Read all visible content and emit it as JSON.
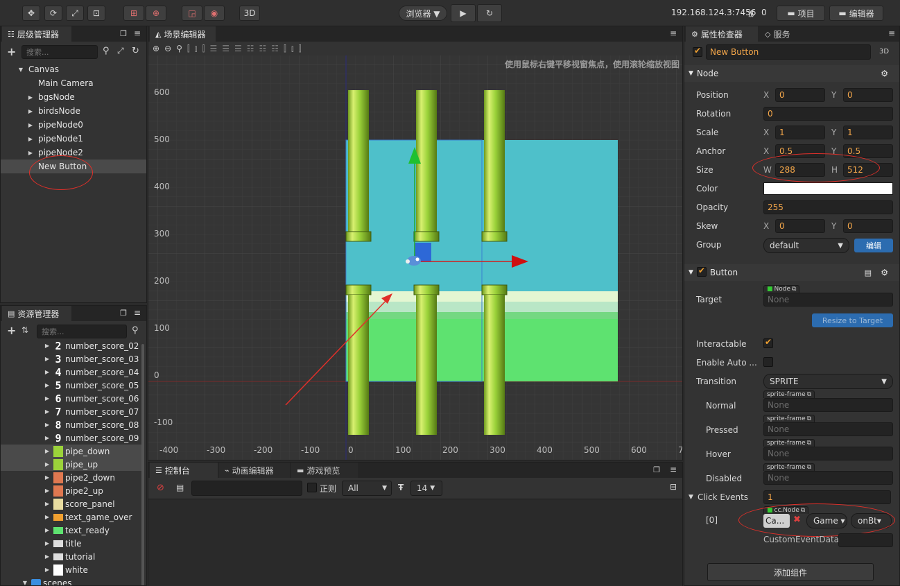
{
  "toolbar": {
    "mode_3d": "3D",
    "preview_select": "浏览器 ▼",
    "ip": "192.168.124.3:7456",
    "wifi_count": "0",
    "project_btn": "项目",
    "editor_btn": "编辑器"
  },
  "hierarchy": {
    "tab": "层级管理器",
    "search_placeholder": "搜索...",
    "items": [
      {
        "label": "Canvas",
        "level": 0,
        "arrow": "open"
      },
      {
        "label": "Main Camera",
        "level": 1,
        "arrow": "none"
      },
      {
        "label": "bgsNode",
        "level": 1,
        "arrow": "closed"
      },
      {
        "label": "birdsNode",
        "level": 1,
        "arrow": "closed"
      },
      {
        "label": "pipeNode0",
        "level": 1,
        "arrow": "closed"
      },
      {
        "label": "pipeNode1",
        "level": 1,
        "arrow": "closed"
      },
      {
        "label": "pipeNode2",
        "level": 1,
        "arrow": "closed"
      },
      {
        "label": "New Button",
        "level": 1,
        "arrow": "none",
        "selected": true
      }
    ]
  },
  "assets": {
    "tab": "资源管理器",
    "search_placeholder": "搜索...",
    "items": [
      {
        "label": "number_score_02",
        "glyph": "2",
        "kind": "digit"
      },
      {
        "label": "number_score_03",
        "glyph": "3",
        "kind": "digit"
      },
      {
        "label": "number_score_04",
        "glyph": "4",
        "kind": "digit"
      },
      {
        "label": "number_score_05",
        "glyph": "5",
        "kind": "digit"
      },
      {
        "label": "number_score_06",
        "glyph": "6",
        "kind": "digit"
      },
      {
        "label": "number_score_07",
        "glyph": "7",
        "kind": "digit"
      },
      {
        "label": "number_score_08",
        "glyph": "8",
        "kind": "digit"
      },
      {
        "label": "number_score_09",
        "glyph": "9",
        "kind": "digit"
      },
      {
        "label": "pipe_down",
        "kind": "green",
        "selected": true
      },
      {
        "label": "pipe_up",
        "kind": "green",
        "selected": true
      },
      {
        "label": "pipe2_down",
        "kind": "orange"
      },
      {
        "label": "pipe2_up",
        "kind": "orange"
      },
      {
        "label": "score_panel",
        "kind": "beige"
      },
      {
        "label": "text_game_over",
        "kind": "gameover"
      },
      {
        "label": "text_ready",
        "kind": "ready"
      },
      {
        "label": "title",
        "kind": "title"
      },
      {
        "label": "tutorial",
        "kind": "tutorial"
      },
      {
        "label": "white",
        "kind": "white"
      },
      {
        "label": "scenes",
        "kind": "folder"
      }
    ]
  },
  "scene": {
    "tab": "场景编辑器",
    "hint": "使用鼠标右键平移视窗焦点，使用滚轮缩放视图",
    "y_labels": [
      "600",
      "500",
      "400",
      "300",
      "200",
      "100",
      "0",
      "-100"
    ],
    "x_labels": [
      "-400",
      "-300",
      "-200",
      "-100",
      "0",
      "100",
      "200",
      "300",
      "400",
      "500",
      "600",
      "7"
    ]
  },
  "console": {
    "tabs": [
      "控制台",
      "动画编辑器",
      "游戏预览"
    ],
    "regex_label": "正则",
    "level_select": "All",
    "font_size": "14"
  },
  "inspector": {
    "tabs": [
      "属性检查器",
      "服务"
    ],
    "node_name": "New Button",
    "mode_3d": "3D",
    "node_section": "Node",
    "position": {
      "label": "Position",
      "x": "0",
      "y": "0"
    },
    "rotation": {
      "label": "Rotation",
      "value": "0"
    },
    "scale": {
      "label": "Scale",
      "x": "1",
      "y": "1"
    },
    "anchor": {
      "label": "Anchor",
      "x": "0.5",
      "y": "0.5"
    },
    "size": {
      "label": "Size",
      "w": "288",
      "h": "512"
    },
    "color_label": "Color",
    "opacity": {
      "label": "Opacity",
      "value": "255"
    },
    "skew": {
      "label": "Skew",
      "x": "0",
      "y": "0"
    },
    "group": {
      "label": "Group",
      "value": "default",
      "edit": "编辑"
    },
    "button_section": "Button",
    "target": {
      "label": "Target",
      "tag": "Node",
      "value": "None"
    },
    "resize_btn": "Resize to Target",
    "interactable": "Interactable",
    "enable_auto": "Enable Auto ...",
    "transition": {
      "label": "Transition",
      "value": "SPRITE"
    },
    "sprite_rows": [
      {
        "label": "Normal",
        "tag": "sprite-frame",
        "value": "None"
      },
      {
        "label": "Pressed",
        "tag": "sprite-frame",
        "value": "None"
      },
      {
        "label": "Hover",
        "tag": "sprite-frame",
        "value": "None"
      },
      {
        "label": "Disabled",
        "tag": "sprite-frame",
        "value": "None"
      }
    ],
    "click_events": {
      "label": "Click Events",
      "value": "1"
    },
    "event0": {
      "index": "[0]",
      "tag": "cc.Node",
      "node": "Ca...",
      "component": "Game ▾",
      "handler": "onBt▾"
    },
    "custom_event": "CustomEventData",
    "add_component": "添加组件"
  },
  "colors": {
    "accent": "#f3a64a",
    "sky": "#4ec0ca",
    "ground": "#5ee270",
    "pipe": "#9bd23a",
    "annotation": "#e0302a"
  }
}
